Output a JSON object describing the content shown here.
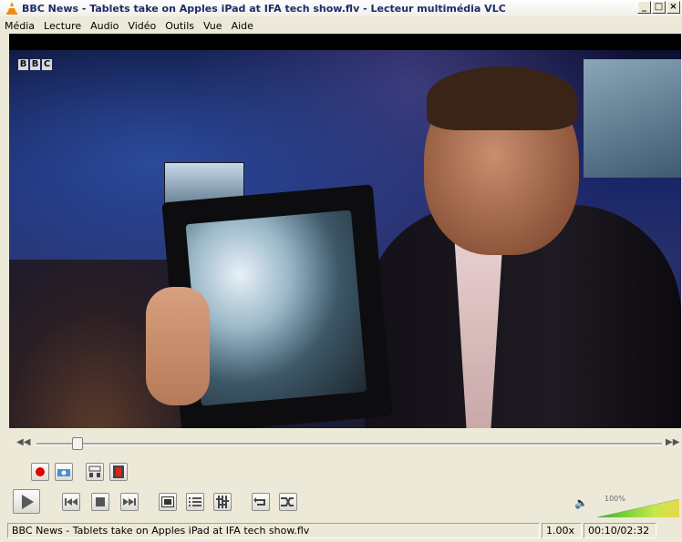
{
  "window": {
    "title": "BBC News - Tablets take on Apples iPad at IFA tech show.flv - Lecteur multimédia VLC",
    "minimize": "_",
    "maximize": "□",
    "close": "×"
  },
  "menu": [
    "Média",
    "Lecture",
    "Audio",
    "Vidéo",
    "Outils",
    "Vue",
    "Aide"
  ],
  "video": {
    "logo_letters": [
      "B",
      "B",
      "C"
    ]
  },
  "seek": {
    "position": 0.066,
    "left_glyph": "◀◀",
    "right_glyph": "▶▶"
  },
  "controls": {
    "advanced": [
      "record-icon",
      "snapshot-icon",
      "loop-ab-icon",
      "frame-step-icon"
    ],
    "main": [
      "play-icon",
      "previous-icon",
      "stop-icon",
      "next-icon",
      "fullscreen-icon",
      "playlist-icon",
      "extended-settings-icon",
      "loop-icon",
      "shuffle-icon"
    ]
  },
  "volume": {
    "label": "100%",
    "level": 1.0
  },
  "status": {
    "filename": "BBC News - Tablets take on Apples iPad at IFA tech show.flv",
    "speed": "1.00x",
    "time": "00:10/02:32"
  },
  "colors": {
    "record": "#e00000",
    "title_text": "#1a2c6b",
    "volume_green": "#4cc84c"
  }
}
